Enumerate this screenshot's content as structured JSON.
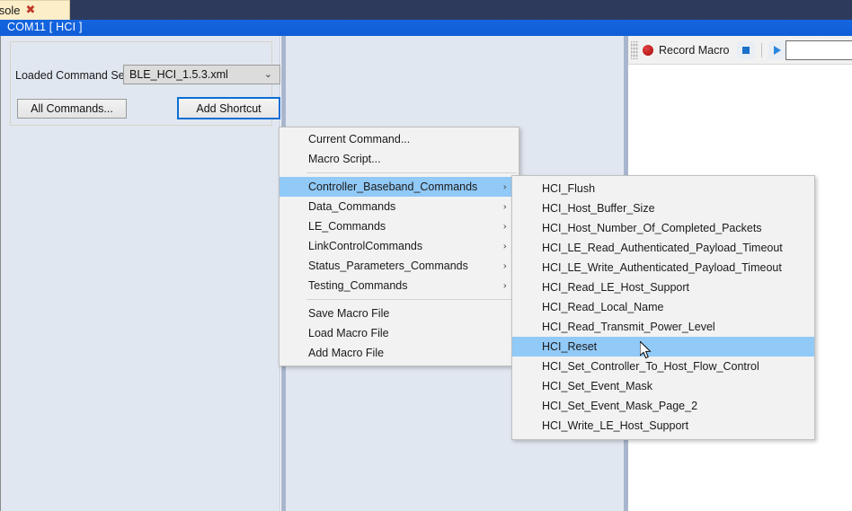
{
  "tab": {
    "label": "d Console",
    "close_icon": "✖"
  },
  "window": {
    "title": "COM11 [ HCI ]"
  },
  "left_panel": {
    "loaded_command_set_label": "Loaded Command Set",
    "loaded_command_set_value": "BLE_HCI_1.5.3.xml",
    "dropdown_chevron": "⌄",
    "all_commands_button": "All Commands...",
    "add_shortcut_button": "Add Shortcut"
  },
  "macro_toolbar": {
    "record_label": "Record Macro",
    "record_dot_color": "#c01818",
    "stop_label": "",
    "play_label": "",
    "accent_color": "#2a86dd",
    "macro_name_value": "",
    "macro_name_placeholder": ""
  },
  "context_menu": {
    "items": [
      {
        "label": "Current Command...",
        "submenu": false,
        "highlighted": false
      },
      {
        "label": "Macro Script...",
        "submenu": false,
        "highlighted": false
      },
      {
        "separator": true
      },
      {
        "label": "Controller_Baseband_Commands",
        "submenu": true,
        "highlighted": true
      },
      {
        "label": "Data_Commands",
        "submenu": true,
        "highlighted": false
      },
      {
        "label": "LE_Commands",
        "submenu": true,
        "highlighted": false
      },
      {
        "label": "LinkControlCommands",
        "submenu": true,
        "highlighted": false
      },
      {
        "label": "Status_Parameters_Commands",
        "submenu": true,
        "highlighted": false
      },
      {
        "label": "Testing_Commands",
        "submenu": true,
        "highlighted": false
      },
      {
        "separator": true
      },
      {
        "label": "Save Macro File",
        "submenu": false,
        "highlighted": false
      },
      {
        "label": "Load Macro File",
        "submenu": false,
        "highlighted": false
      },
      {
        "label": "Add Macro File",
        "submenu": false,
        "highlighted": false
      }
    ],
    "submenu_arrow": "›"
  },
  "submenu": {
    "parent": "Controller_Baseband_Commands",
    "items": [
      {
        "label": "HCI_Flush",
        "highlighted": false
      },
      {
        "label": "HCI_Host_Buffer_Size",
        "highlighted": false
      },
      {
        "label": "HCI_Host_Number_Of_Completed_Packets",
        "highlighted": false
      },
      {
        "label": "HCI_LE_Read_Authenticated_Payload_Timeout",
        "highlighted": false
      },
      {
        "label": "HCI_LE_Write_Authenticated_Payload_Timeout",
        "highlighted": false
      },
      {
        "label": "HCI_Read_LE_Host_Support",
        "highlighted": false
      },
      {
        "label": "HCI_Read_Local_Name",
        "highlighted": false
      },
      {
        "label": "HCI_Read_Transmit_Power_Level",
        "highlighted": false
      },
      {
        "label": "HCI_Reset",
        "highlighted": true
      },
      {
        "label": "HCI_Set_Controller_To_Host_Flow_Control",
        "highlighted": false
      },
      {
        "label": "HCI_Set_Event_Mask",
        "highlighted": false
      },
      {
        "label": "HCI_Set_Event_Mask_Page_2",
        "highlighted": false
      },
      {
        "label": "HCI_Write_LE_Host_Support",
        "highlighted": false
      }
    ]
  },
  "colors": {
    "title_bar": "#0f5ed8",
    "menu_highlight": "#91c9f7",
    "panel_background": "#e1e7f0",
    "focus_border": "#0b6ed6"
  }
}
